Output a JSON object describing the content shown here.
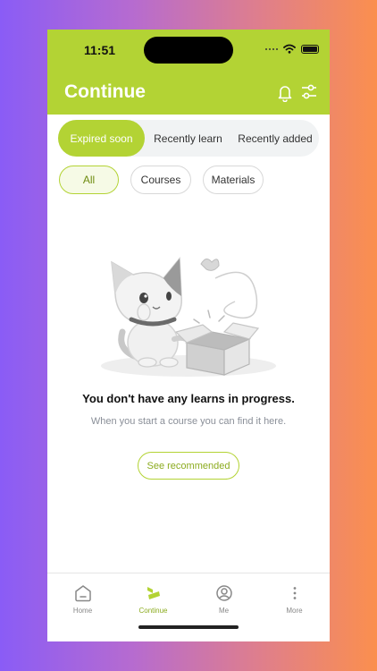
{
  "status": {
    "time": "11:51"
  },
  "header": {
    "title": "Continue",
    "bg": "#b3d334"
  },
  "tabs": [
    {
      "label": "Expired soon",
      "active": true
    },
    {
      "label": "Recently learn",
      "active": false
    },
    {
      "label": "Recently added",
      "active": false
    }
  ],
  "filters": [
    {
      "label": "All",
      "active": true
    },
    {
      "label": "Courses",
      "active": false
    },
    {
      "label": "Materials",
      "active": false
    }
  ],
  "empty": {
    "title": "You don't have any learns in progress.",
    "subtitle": "When you start a course you can find it here.",
    "button": "See recommended"
  },
  "nav": [
    {
      "label": "Home",
      "icon": "home-icon",
      "active": false
    },
    {
      "label": "Continue",
      "icon": "continue-icon",
      "active": true
    },
    {
      "label": "Me",
      "icon": "profile-icon",
      "active": false
    },
    {
      "label": "More",
      "icon": "more-icon",
      "active": false
    }
  ],
  "colors": {
    "accent": "#b3d334",
    "accent_text": "#8bab1e"
  }
}
